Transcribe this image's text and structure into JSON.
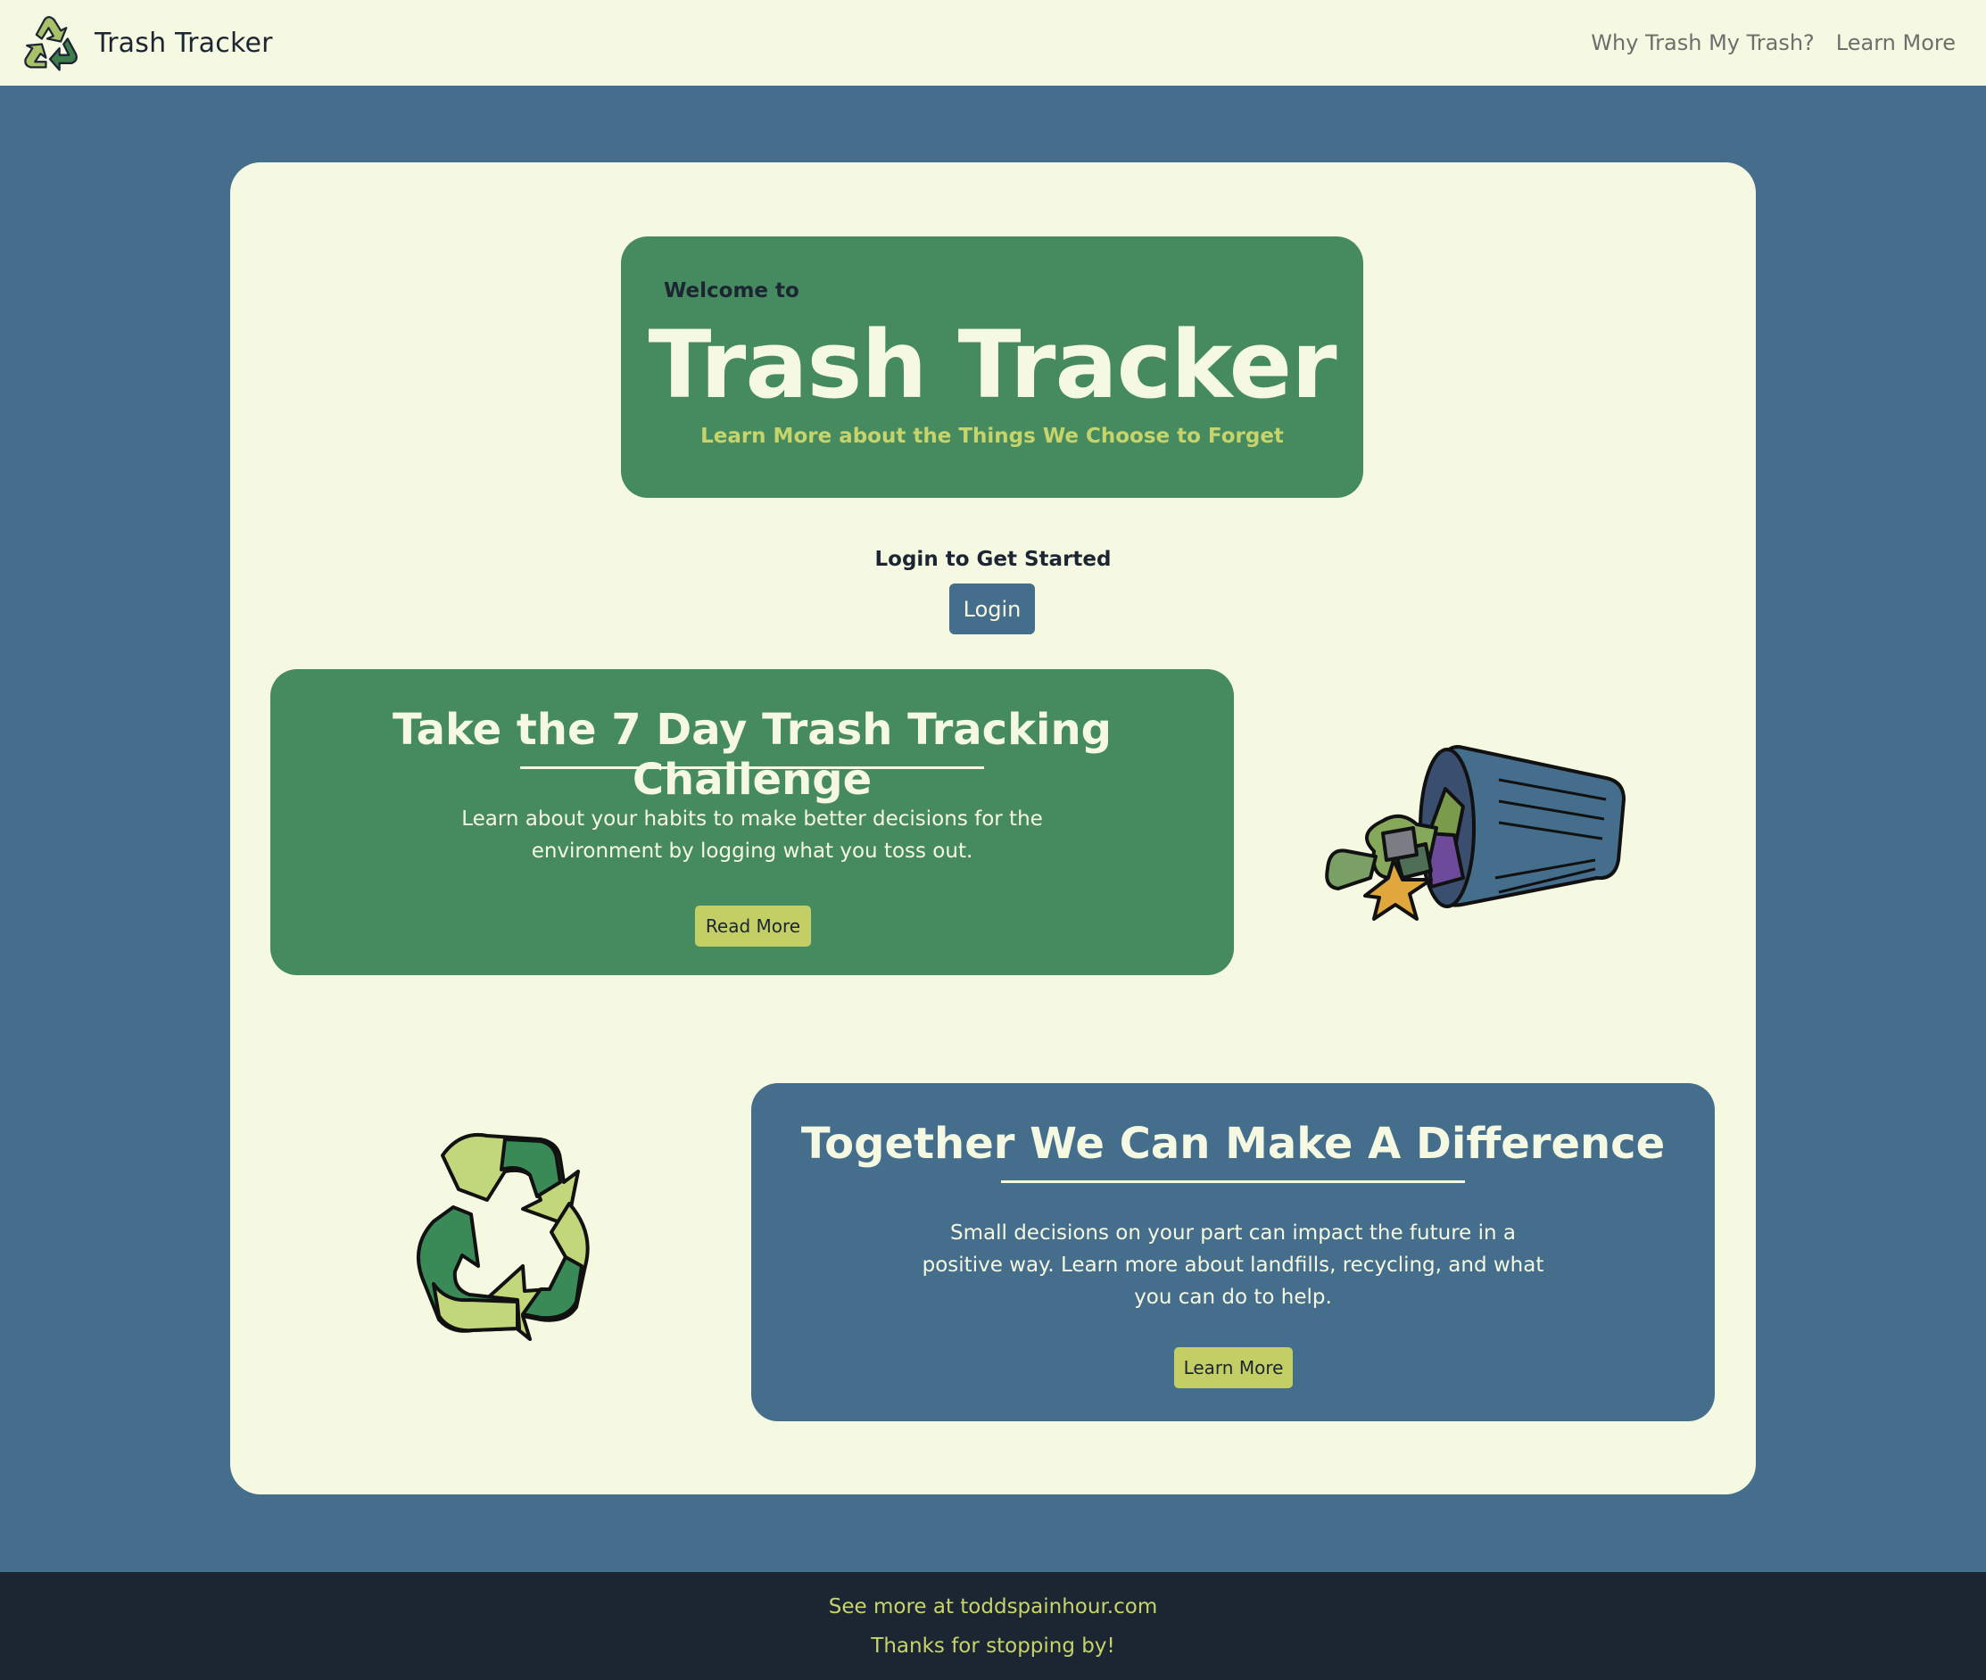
{
  "navbar": {
    "brand": "Trash Tracker",
    "logo_icon": "recycle-icon",
    "links": [
      "Why Trash My Trash?",
      "Learn More"
    ]
  },
  "hero": {
    "pre": "Welcome to",
    "title": "Trash Tracker",
    "subtitle": "Learn More about the Things We Choose to Forget"
  },
  "login": {
    "label": "Login to Get Started",
    "button": "Login"
  },
  "challenge": {
    "title": "Take the 7 Day Trash Tracking Challenge",
    "body_line1": "Learn about your habits to make better decisions for the",
    "body_line2": "environment by logging what you toss out.",
    "button": "Read More",
    "image_icon": "trashcan-icon"
  },
  "difference": {
    "title": "Together We Can Make A Difference",
    "body_line1": "Small decisions on your part can impact the future in a",
    "body_line2": "positive way. Learn more about landfills, recycling, and what",
    "body_line3": "you can do to help.",
    "button": "Learn More",
    "image_icon": "recycle-icon"
  },
  "footer": {
    "line1": "See more at toddspainhour.com",
    "line2": "Thanks for stopping by!"
  },
  "colors": {
    "page_bg": "#446e8b",
    "cream": "#f6f9e1",
    "green": "#468b5f",
    "yellow": "#c3cf64",
    "dark": "#1c2532"
  }
}
